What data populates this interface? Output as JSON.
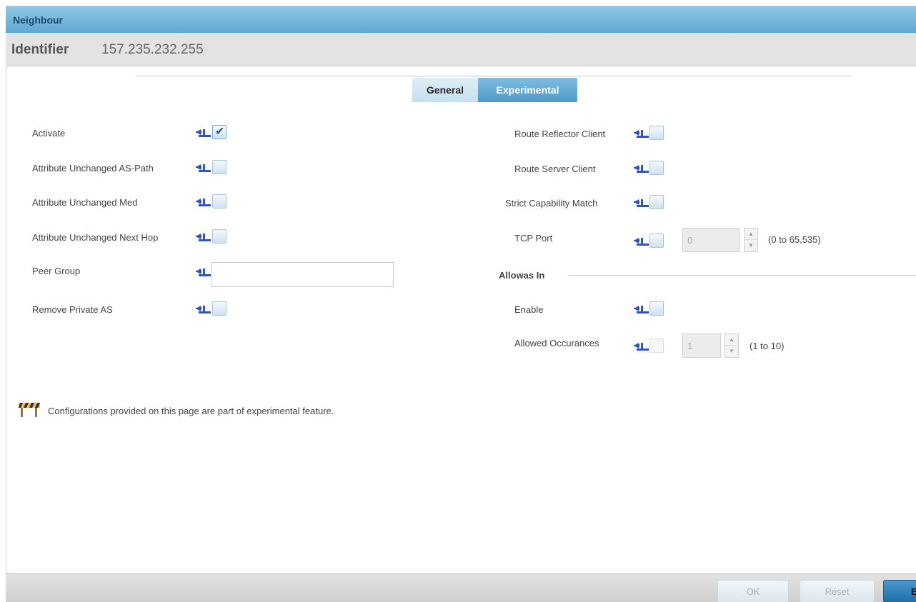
{
  "window": {
    "title": "Neighbour"
  },
  "identifier": {
    "label": "Identifier",
    "value": "157.235.232.255"
  },
  "tabs": [
    {
      "label": "General",
      "active": false
    },
    {
      "label": "Experimental",
      "active": true
    }
  ],
  "left_fields": [
    {
      "label": "Activate",
      "checked": true
    },
    {
      "label": "Attribute Unchanged AS-Path",
      "checked": false
    },
    {
      "label": "Attribute Unchanged Med",
      "checked": false
    },
    {
      "label": "Attribute Unchanged Next Hop",
      "checked": false
    },
    {
      "label": "Peer Group",
      "value": ""
    },
    {
      "label": "Remove Private AS",
      "checked": false
    }
  ],
  "right_fields": [
    {
      "label": "Route Reflector Client",
      "checked": false
    },
    {
      "label": "Route Server Client",
      "checked": false
    },
    {
      "label": "Strict Capability Match",
      "checked": false
    },
    {
      "label": "TCP Port",
      "checked": false,
      "value": "0",
      "range": "(0 to 65,535)"
    }
  ],
  "allowas_in": {
    "title": "Allowas In",
    "enable": {
      "label": "Enable",
      "checked": false
    },
    "occurrences": {
      "label": "Allowed Occurances",
      "value": "1",
      "range": "(1 to 10)"
    }
  },
  "note": "Configurations provided on this page are part of experimental feature.",
  "footer": {
    "ok_label": "OK",
    "reset_label": "Reset",
    "exit_label": "E"
  },
  "colors": {
    "title_bar": "#5ea9d2",
    "tab_active": "#4f9bc9",
    "pin_icon": "#2f55b8"
  }
}
